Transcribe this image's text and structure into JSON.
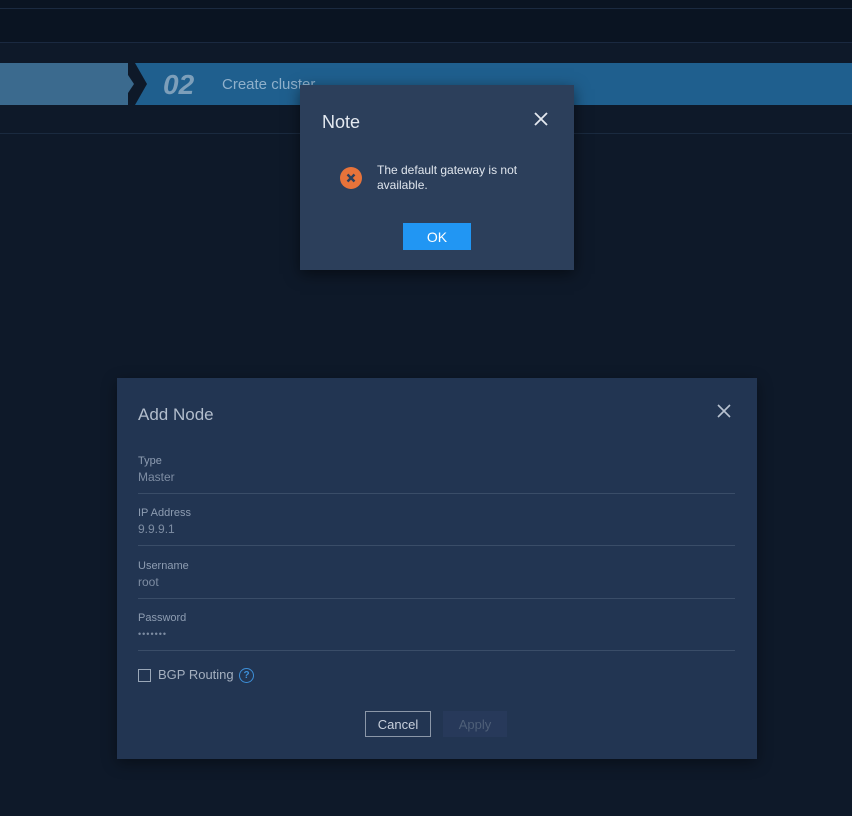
{
  "wizard": {
    "step_number": "02",
    "step_label": "Create cluster"
  },
  "note_dialog": {
    "title": "Note",
    "message": "The default gateway is not available.",
    "ok_label": "OK",
    "icon": "error-icon",
    "icon_color": "#e8733a"
  },
  "add_node_dialog": {
    "title": "Add Node",
    "fields": [
      {
        "label": "Type",
        "value": "Master"
      },
      {
        "label": "IP Address",
        "value": "9.9.9.1"
      },
      {
        "label": "Username",
        "value": "root"
      },
      {
        "label": "Password",
        "value": "•••••••"
      }
    ],
    "bgp_label": "BGP Routing",
    "bgp_checked": false,
    "help_glyph": "?",
    "cancel_label": "Cancel",
    "apply_label": "Apply"
  },
  "colors": {
    "accent": "#2196f3",
    "background": "#0e1929",
    "dialog": "#223552"
  }
}
